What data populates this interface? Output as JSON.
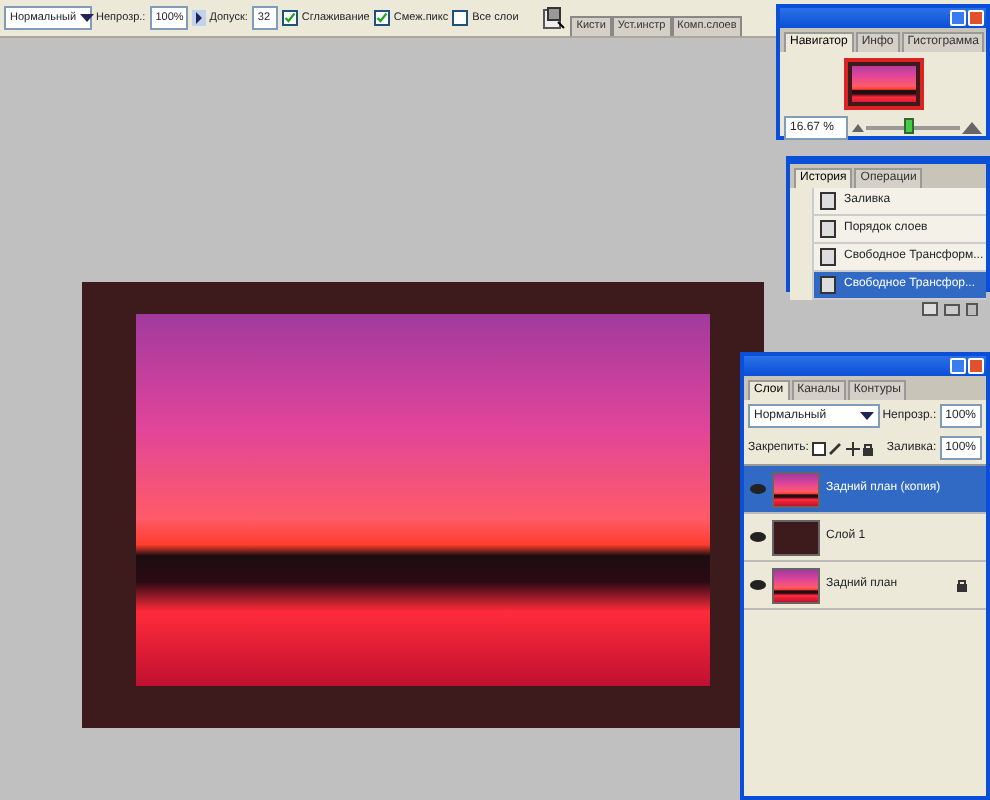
{
  "options_bar": {
    "mode": "Нормальный",
    "opacity_label": "Непрозр.:",
    "opacity": "100%",
    "tolerance_label": "Допуск:",
    "tolerance": "32",
    "checkboxes": [
      {
        "label": "Сглаживание",
        "checked": true
      },
      {
        "label": "Смеж.пикс",
        "checked": true
      },
      {
        "label": "Все слои",
        "checked": false
      }
    ]
  },
  "palette_well": {
    "tabs": [
      "Кисти",
      "Уст.инстр",
      "Комп.слоев"
    ]
  },
  "navigator": {
    "tabs": [
      {
        "label": "Навигатор",
        "selected": true
      },
      {
        "label": "Инфо",
        "selected": false
      },
      {
        "label": "Гистограмма",
        "selected": false
      }
    ],
    "zoom": "16.67 %",
    "zoom_slider": {
      "level": 0.4
    }
  },
  "history": {
    "tabs": [
      {
        "label": "История",
        "selected": true
      },
      {
        "label": "Операции",
        "selected": false
      }
    ],
    "items": [
      {
        "label": "Заливка",
        "selected": false
      },
      {
        "label": "Порядок слоев",
        "selected": false
      },
      {
        "label": "Свободное Трансформ...",
        "selected": false
      },
      {
        "label": "Свободное Трансфор...",
        "selected": true
      }
    ]
  },
  "layers": {
    "tabs": [
      {
        "label": "Слои",
        "selected": true
      },
      {
        "label": "Каналы",
        "selected": false
      },
      {
        "label": "Контуры",
        "selected": false
      }
    ],
    "blend_mode": "Нормальный",
    "opacity_label": "Непрозр.:",
    "opacity": "100%",
    "lock_label": "Закрепить:",
    "fill_label": "Заливка:",
    "fill": "100%",
    "items": [
      {
        "name": "Задний план (копия)",
        "selected": true,
        "visible": true,
        "locked": false,
        "kind": "photo"
      },
      {
        "name": "Слой 1",
        "selected": false,
        "visible": true,
        "locked": false,
        "kind": "solid"
      },
      {
        "name": "Задний план",
        "selected": false,
        "visible": true,
        "locked": true,
        "kind": "photo"
      }
    ]
  }
}
